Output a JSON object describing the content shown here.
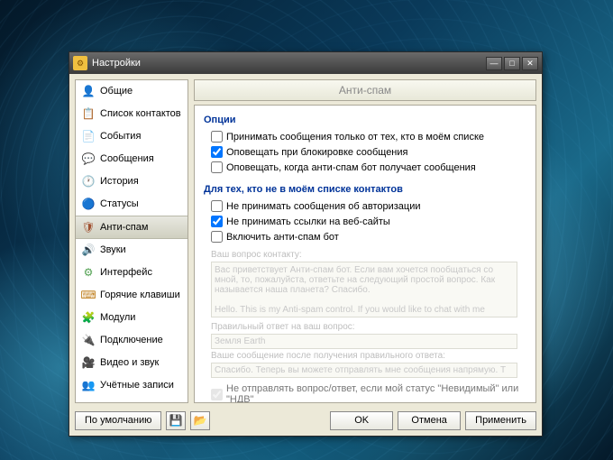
{
  "window": {
    "title": "Настройки"
  },
  "nav": [
    {
      "label": "Общие",
      "icon": "👤",
      "color": "#d4a020"
    },
    {
      "label": "Список контактов",
      "icon": "📋",
      "color": "#c04040"
    },
    {
      "label": "События",
      "icon": "📄",
      "color": "#8090a0"
    },
    {
      "label": "Сообщения",
      "icon": "💬",
      "color": "#50a050"
    },
    {
      "label": "История",
      "icon": "🕐",
      "color": "#4060c0"
    },
    {
      "label": "Статусы",
      "icon": "🔵",
      "color": "#4080c0"
    },
    {
      "label": "Анти-спам",
      "icon": "🛡",
      "color": "#a05030",
      "active": true
    },
    {
      "label": "Звуки",
      "icon": "🔊",
      "color": "#4060c0"
    },
    {
      "label": "Интерфейс",
      "icon": "⚙",
      "color": "#50a050"
    },
    {
      "label": "Горячие клавиши",
      "icon": "⌨",
      "color": "#c08020"
    },
    {
      "label": "Модули",
      "icon": "🧩",
      "color": "#4060c0"
    },
    {
      "label": "Подключение",
      "icon": "🔌",
      "color": "#50a050"
    },
    {
      "label": "Видео и звук",
      "icon": "🎥",
      "color": "#606060"
    },
    {
      "label": "Учётные записи",
      "icon": "👥",
      "color": "#40a080"
    }
  ],
  "panel": {
    "title": "Анти-спам",
    "section1": {
      "head": "Опции",
      "opt1": {
        "label": "Принимать сообщения только от тех, кто в моём списке",
        "checked": false
      },
      "opt2": {
        "label": "Оповещать при блокировке сообщения",
        "checked": true
      },
      "opt3": {
        "label": "Оповещать, когда анти-спам бот получает сообщения",
        "checked": false
      }
    },
    "section2": {
      "head": "Для тех, кто не в моём списке контактов",
      "opt1": {
        "label": "Не принимать сообщения об авторизации",
        "checked": false
      },
      "opt2": {
        "label": "Не принимать ссылки на веб-сайты",
        "checked": true
      },
      "opt3": {
        "label": "Включить анти-спам бот",
        "checked": false
      }
    },
    "disabled": {
      "question_label": "Ваш вопрос контакту:",
      "question_text": "Вас приветствует Анти-спам бот. Если вам хочется пообщаться со мной, то, пожалуйста, ответьте на следующий простой вопрос. Как называется наша планета? Спасибо.\n\nHello. This is my Anti-spam control. If you would like to chat with me",
      "answer_label": "Правильный ответ на ваш вопрос:",
      "answer_text": "Земля Earth",
      "reply_label": "Ваше сообщение после получения правильного ответа:",
      "reply_text": "Спасибо. Теперь вы можете отправлять мне сообщения напрямую. T",
      "nosend": {
        "label": "Не отправлять вопрос/ответ, если мой статус \"Невидимый\" или \"НДВ\"",
        "checked": true
      }
    }
  },
  "footer": {
    "defaults": "По умолчанию",
    "ok": "OK",
    "cancel": "Отмена",
    "apply": "Применить"
  }
}
